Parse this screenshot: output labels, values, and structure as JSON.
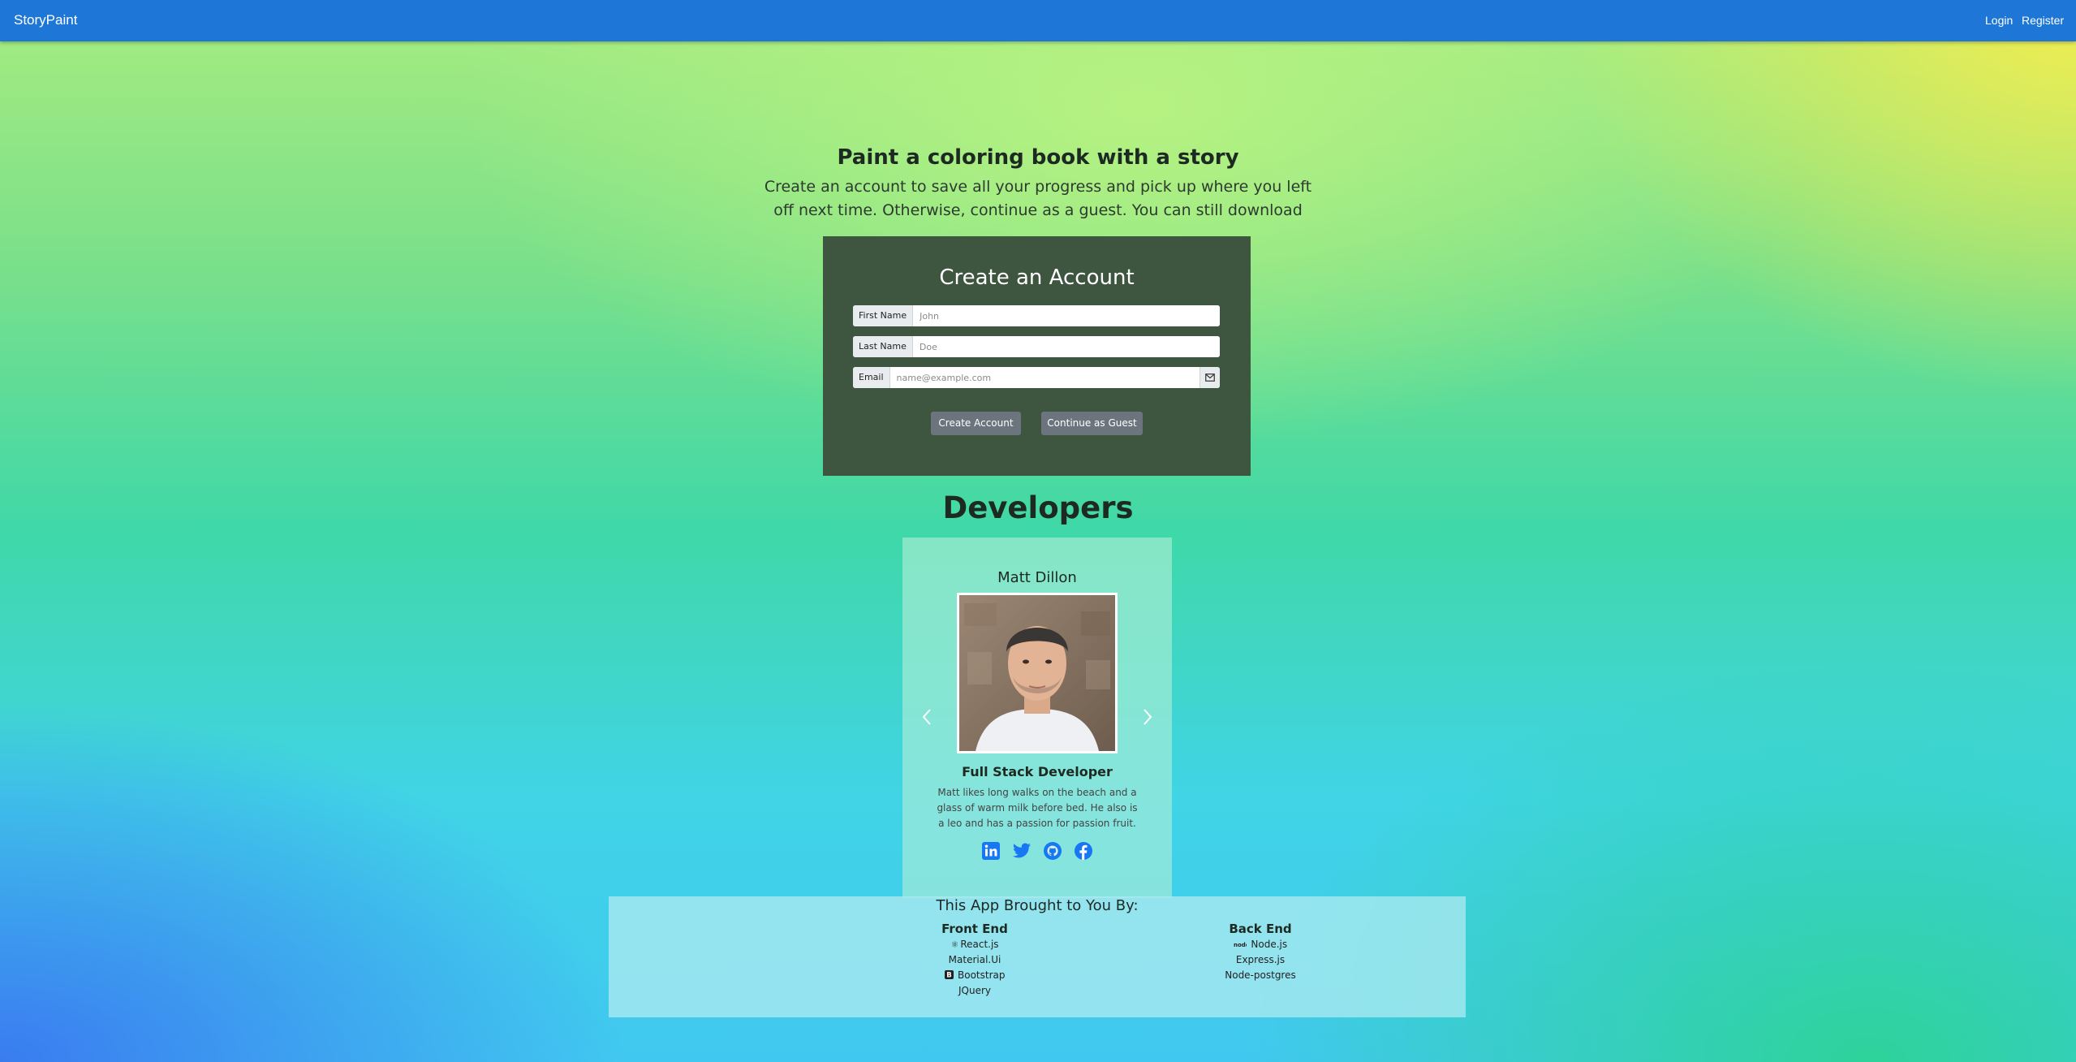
{
  "navbar": {
    "brand": "StoryPaint",
    "links": [
      "Login",
      "Register"
    ]
  },
  "hero": {
    "title": "Paint a coloring book with a story",
    "subtitle": "Create an account to save all your progress and pick up where you left off next time. Otherwise, continue as a guest. You can still download"
  },
  "signup": {
    "title": "Create an Account",
    "fields": [
      {
        "label": "First Name",
        "value": "",
        "placeholder": "John"
      },
      {
        "label": "Last Name",
        "value": "",
        "placeholder": "Doe"
      },
      {
        "label": "Email",
        "value": "",
        "placeholder": "name@example.com",
        "icon": "envelope-icon"
      }
    ],
    "buttons": {
      "create": "Create Account",
      "guest": "Continue as Guest"
    }
  },
  "developers": {
    "heading": "Developers",
    "current": {
      "name": "Matt Dillon",
      "role": "Full Stack Developer",
      "bio": "Matt likes long walks on the beach and a glass of warm milk before bed. He also is a leo and has a passion for passion fruit.",
      "socials": [
        "linkedin-icon",
        "twitter-icon",
        "github-icon",
        "facebook-icon"
      ]
    }
  },
  "tech": {
    "title": "This App Brought to You By:",
    "front_end": {
      "title": "Front End",
      "items": [
        "React.js",
        "Material.Ui",
        "Bootstrap",
        "JQuery"
      ]
    },
    "back_end": {
      "title": "Back End",
      "items": [
        "Node.js",
        "Express.js",
        "Node-postgres"
      ]
    }
  },
  "colors": {
    "navbar": "#1e77d6",
    "card": "#3e5540",
    "button": "#6c757d",
    "social": "#1877f2"
  }
}
